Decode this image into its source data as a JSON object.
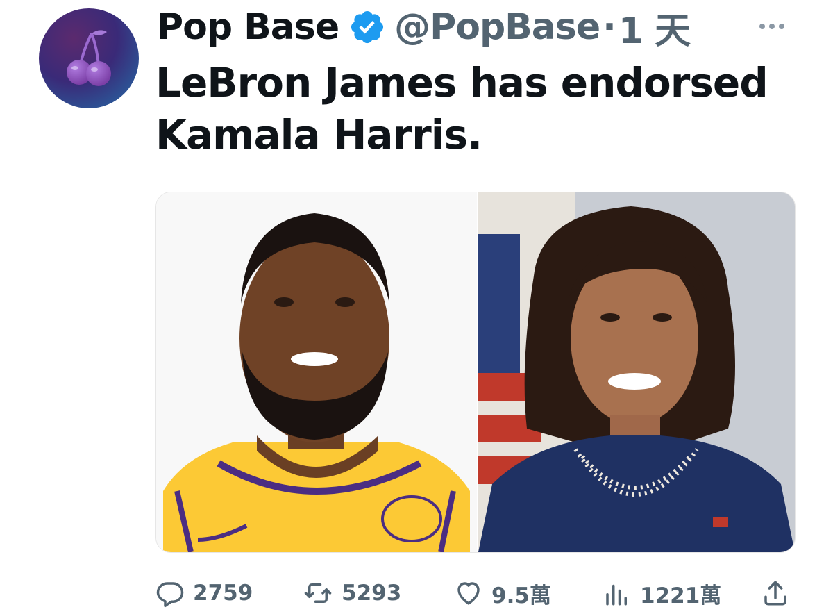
{
  "author": {
    "name": "Pop Base",
    "handle": "@PopBase",
    "separator": "·",
    "time": "1 天",
    "verified": true,
    "verified_color": "#1d9bf0",
    "avatar_icon": "cherries-icon",
    "avatar_colors": [
      "#2b2f7a",
      "#5b2a6e",
      "#7b3fa6"
    ]
  },
  "more_icon": "more-horizontal-icon",
  "tweet_text": "LeBron James has endorsed Kamala Harris.",
  "media": [
    {
      "icon": "photo-lebron-james",
      "colors": [
        "#fbd04a",
        "#4b2d82"
      ]
    },
    {
      "icon": "photo-kamala-harris",
      "colors": [
        "#1d2f5e",
        "#c9ccd2"
      ]
    }
  ],
  "actions": {
    "reply": {
      "icon": "reply-icon",
      "count": "2759"
    },
    "retweet": {
      "icon": "retweet-icon",
      "count": "5293"
    },
    "like": {
      "icon": "like-icon",
      "count": "9.5萬"
    },
    "views": {
      "icon": "views-icon",
      "count": "1221萬"
    },
    "share": {
      "icon": "share-icon"
    }
  },
  "muted_color": "#536471"
}
